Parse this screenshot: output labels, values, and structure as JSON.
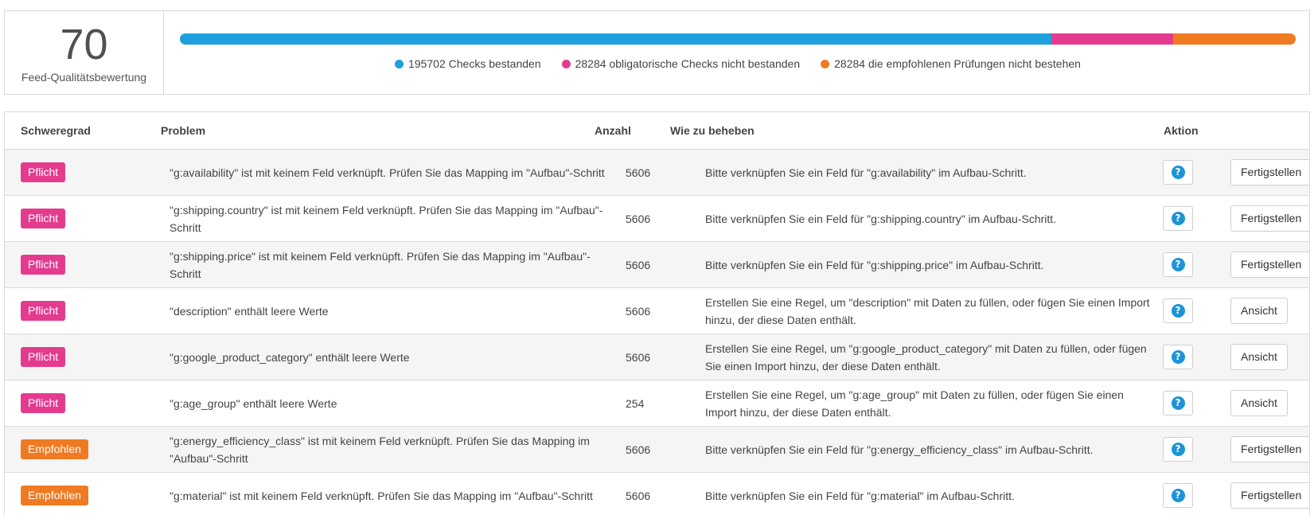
{
  "score": {
    "value": "70",
    "label": "Feed-Qualitätsbewertung"
  },
  "bar": {
    "passed_fraction": 0.7808,
    "mandatory_fraction": 0.1096,
    "recommended_fraction": 0.1096,
    "colors": {
      "passed": "#1fa0dd",
      "mandatory": "#e43b8f",
      "recommended": "#f07a22"
    }
  },
  "legend": [
    {
      "text": "195702 Checks bestanden",
      "color": "#1fa0dd"
    },
    {
      "text": "28284 obligatorische Checks nicht bestanden",
      "color": "#e43b8f"
    },
    {
      "text": "28284 die empfohlenen Prüfungen nicht bestehen",
      "color": "#f07a22"
    }
  ],
  "table": {
    "headers": {
      "severity": "Schweregrad",
      "problem": "Problem",
      "count": "Anzahl",
      "fix": "Wie zu beheben",
      "action": "Aktion"
    },
    "help_icon": "question-circle-icon",
    "rows": [
      {
        "severity": "Pflicht",
        "severity_type": "mandatory",
        "problem": "\"g:availability\" ist mit keinem Feld verknüpft. Prüfen Sie das Mapping im \"Aufbau\"-Schritt",
        "count": "5606",
        "fix": "Bitte verknüpfen Sie ein Feld für \"g:availability\" im Aufbau-Schritt.",
        "action": "Fertigstellen"
      },
      {
        "severity": "Pflicht",
        "severity_type": "mandatory",
        "problem": "\"g:shipping.country\" ist mit keinem Feld verknüpft. Prüfen Sie das Mapping im \"Aufbau\"-Schritt",
        "count": "5606",
        "fix": "Bitte verknüpfen Sie ein Feld für \"g:shipping.country\" im Aufbau-Schritt.",
        "action": "Fertigstellen"
      },
      {
        "severity": "Pflicht",
        "severity_type": "mandatory",
        "problem": "\"g:shipping.price\" ist mit keinem Feld verknüpft. Prüfen Sie das Mapping im \"Aufbau\"-Schritt",
        "count": "5606",
        "fix": "Bitte verknüpfen Sie ein Feld für \"g:shipping.price\" im Aufbau-Schritt.",
        "action": "Fertigstellen"
      },
      {
        "severity": "Pflicht",
        "severity_type": "mandatory",
        "problem": "\"description\" enthält leere Werte",
        "count": "5606",
        "fix": "Erstellen Sie eine Regel, um \"description\" mit Daten zu füllen, oder fügen Sie einen Import hinzu, der diese Daten enthält.",
        "action": "Ansicht"
      },
      {
        "severity": "Pflicht",
        "severity_type": "mandatory",
        "problem": "\"g:google_product_category\" enthält leere Werte",
        "count": "5606",
        "fix": "Erstellen Sie eine Regel, um \"g:google_product_category\" mit Daten zu füllen, oder fügen Sie einen Import hinzu, der diese Daten enthält.",
        "action": "Ansicht"
      },
      {
        "severity": "Pflicht",
        "severity_type": "mandatory",
        "problem": "\"g:age_group\" enthält leere Werte",
        "count": "254",
        "fix": "Erstellen Sie eine Regel, um \"g:age_group\" mit Daten zu füllen, oder fügen Sie einen Import hinzu, der diese Daten enthält.",
        "action": "Ansicht"
      },
      {
        "severity": "Empfohlen",
        "severity_type": "recommended",
        "problem": "\"g:energy_efficiency_class\" ist mit keinem Feld verknüpft. Prüfen Sie das Mapping im \"Aufbau\"-Schritt",
        "count": "5606",
        "fix": "Bitte verknüpfen Sie ein Feld für \"g:energy_efficiency_class\" im Aufbau-Schritt.",
        "action": "Fertigstellen"
      },
      {
        "severity": "Empfohlen",
        "severity_type": "recommended",
        "problem": "\"g:material\" ist mit keinem Feld verknüpft. Prüfen Sie das Mapping im \"Aufbau\"-Schritt",
        "count": "5606",
        "fix": "Bitte verknüpfen Sie ein Feld für \"g:material\" im Aufbau-Schritt.",
        "action": "Fertigstellen"
      }
    ]
  }
}
